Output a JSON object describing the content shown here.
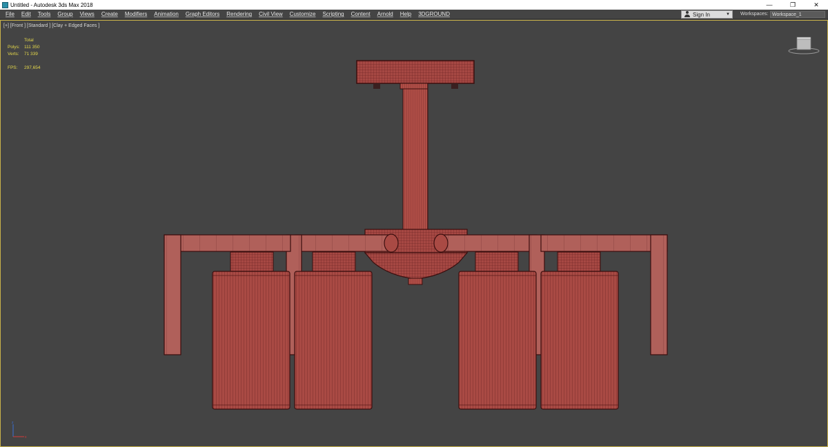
{
  "window": {
    "title": "Untitled - Autodesk 3ds Max 2018",
    "minimize": "—",
    "restore": "❐",
    "close": "✕"
  },
  "menu": {
    "items": [
      "File",
      "Edit",
      "Tools",
      "Group",
      "Views",
      "Create",
      "Modifiers",
      "Animation",
      "Graph Editors",
      "Rendering",
      "Civil View",
      "Customize",
      "Scripting",
      "Content",
      "Arnold",
      "Help",
      "3DGROUND"
    ]
  },
  "account": {
    "signin_label": "Sign In",
    "workspaces_label": "Workspaces:",
    "workspace_value": "Workspace_1"
  },
  "viewport": {
    "label": "[+] [Front ] [Standard ] [Clay + Edged Faces ]",
    "stats": {
      "total_label": "Total",
      "polys_label": "Polys:",
      "polys_value": "111 350",
      "verts_label": "Verts:",
      "verts_value": "71 339",
      "fps_label": "FPS:",
      "fps_value": "297,654"
    }
  },
  "colors": {
    "viewport_bg": "#444444",
    "model_fill": "#a94a44",
    "model_edge": "#4a1414",
    "viewport_border": "#c9b24a",
    "stats_text": "#e6d94a"
  },
  "icons": {
    "app": "3ds-max-icon",
    "user": "user-icon",
    "viewcube": "viewcube-icon",
    "axis": "axis-gizmo-icon"
  }
}
